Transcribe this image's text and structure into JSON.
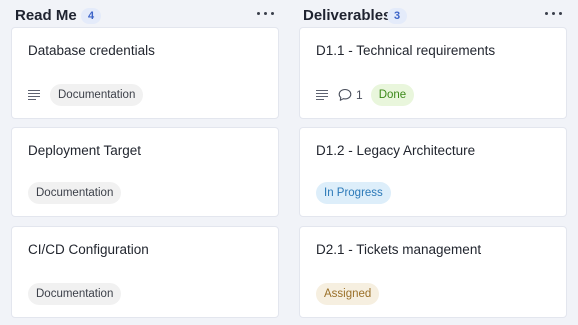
{
  "columns": [
    {
      "title": "Read Me",
      "count": "4",
      "cards": [
        {
          "title": "Database credentials",
          "tag": "Documentation"
        },
        {
          "title": "Deployment Target",
          "tag": "Documentation"
        },
        {
          "title": "CI/CD Configuration",
          "tag": "Documentation"
        }
      ]
    },
    {
      "title": "Deliverables",
      "count": "3",
      "cards": [
        {
          "title": "D1.1 - Technical requirements",
          "comments": "1",
          "tag": "Done"
        },
        {
          "title": "D1.2 - Legacy Architecture",
          "tag": "In Progress"
        },
        {
          "title": "D2.1 - Tickets management",
          "tag": "Assigned"
        }
      ]
    }
  ],
  "icons": {
    "description": "lines-icon",
    "comment": "speech-bubble-icon",
    "menu": "more-horizontal-icon"
  },
  "colors": {
    "done": "#3d8a1a",
    "in_progress": "#2b79b8",
    "assigned": "#9a7029",
    "count_badge": "#3c64c8"
  }
}
